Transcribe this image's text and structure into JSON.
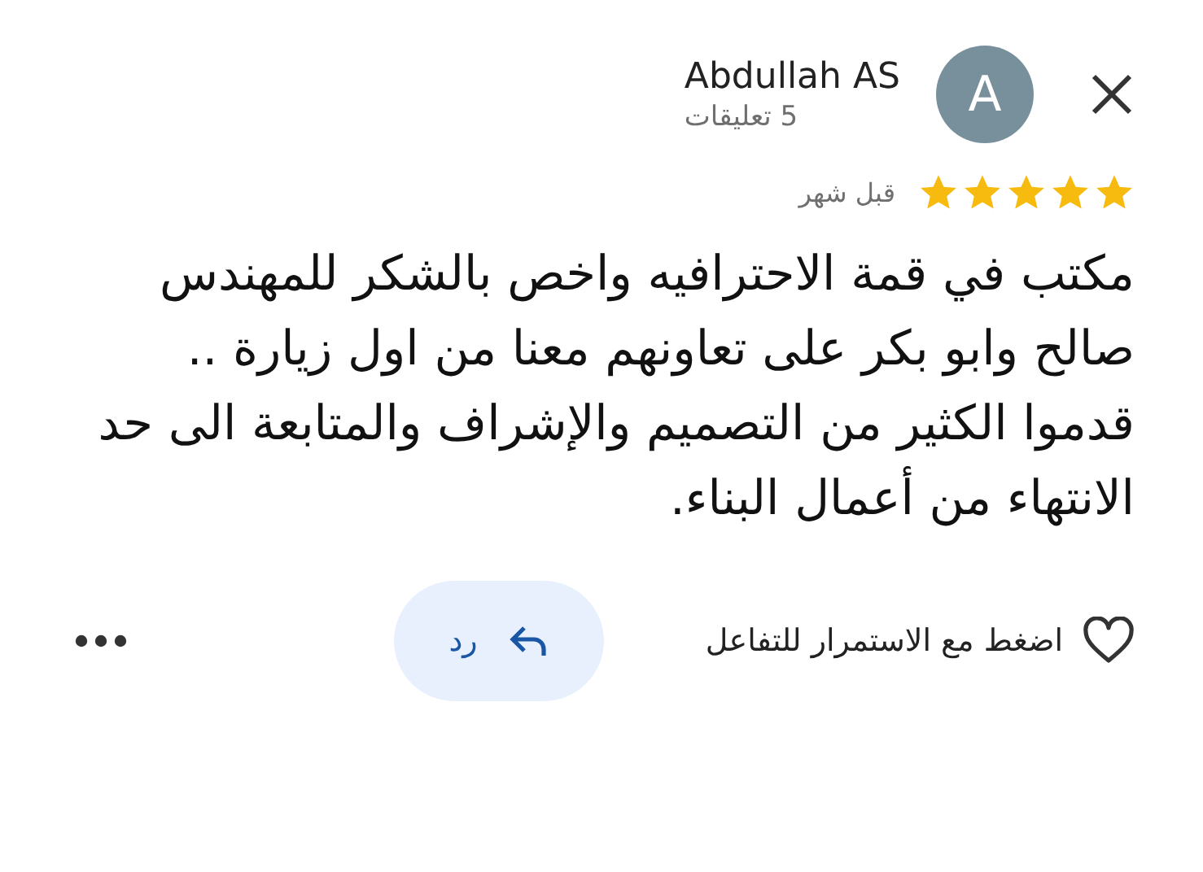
{
  "reviewer": {
    "initial": "A",
    "name": "Abdullah AS",
    "reviews_count": "5 تعليقات"
  },
  "rating": {
    "stars": 5,
    "time": "قبل شهر"
  },
  "review_text": "مكتب في قمة الاحترافيه واخص بالشكر للمهندس صالح وابو بكر على تعاونهم معنا من اول زيارة .. قدموا الكثير من التصميم والإشراف والمتابعة الى حد الانتهاء من أعمال البناء.",
  "actions": {
    "like_hint": "اضغط مع الاستمرار للتفاعل",
    "reply": "رد"
  }
}
